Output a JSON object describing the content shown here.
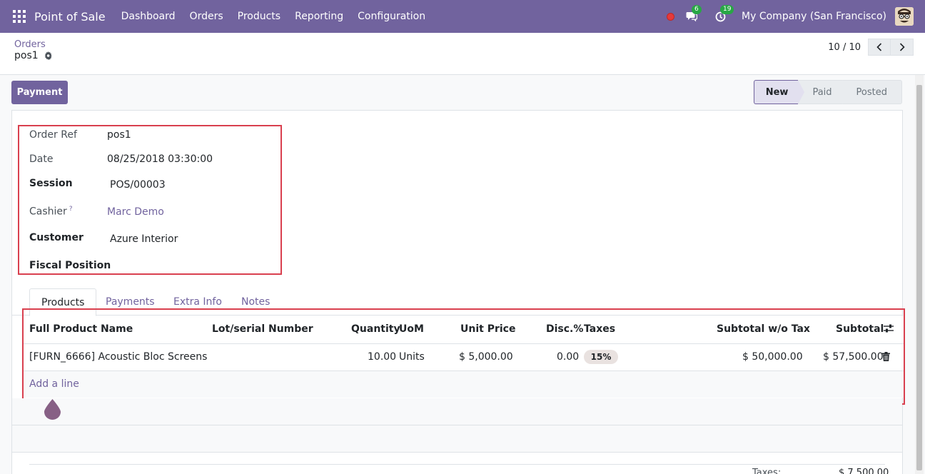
{
  "navbar": {
    "app_title": "Point of Sale",
    "menu": [
      "Dashboard",
      "Orders",
      "Products",
      "Reporting",
      "Configuration"
    ],
    "messages_count": "6",
    "activities_count": "19",
    "company": "My Company (San Francisco)"
  },
  "breadcrumb": {
    "parent": "Orders",
    "current": "pos1"
  },
  "pager": {
    "value": "10 / 10"
  },
  "statusbar": {
    "payment_label": "Payment",
    "steps": [
      "New",
      "Paid",
      "Posted"
    ],
    "active_step": "New"
  },
  "form": {
    "order_ref_label": "Order Ref",
    "order_ref_value": "pos1",
    "date_label": "Date",
    "date_value": "08/25/2018 03:30:00",
    "session_label": "Session",
    "session_value": "POS/00003",
    "cashier_label": "Cashier",
    "cashier_help": "?",
    "cashier_value": "Marc Demo",
    "customer_label": "Customer",
    "customer_value": "Azure Interior",
    "fiscal_label": "Fiscal Position"
  },
  "tabs": [
    "Products",
    "Payments",
    "Extra Info",
    "Notes"
  ],
  "lines": {
    "headers": {
      "product": "Full Product Name",
      "lot": "Lot/serial Number",
      "qty": "Quantity",
      "uom": "UoM",
      "price": "Unit Price",
      "disc": "Disc.%",
      "taxes": "Taxes",
      "subtotal_wo": "Subtotal w/o Tax",
      "subtotal": "Subtotal"
    },
    "row": {
      "product": "[FURN_6666] Acoustic Bloc Screens",
      "qty": "10.00",
      "uom": "Units",
      "price": "$ 5,000.00",
      "disc": "0.00",
      "tax": "15%",
      "subtotal_wo": "$ 50,000.00",
      "subtotal": "$ 57,500.00"
    },
    "add_line": "Add a line"
  },
  "totals": {
    "taxes_label": "Taxes:",
    "taxes_value": "$ 7,500.00"
  },
  "colors": {
    "brand": "#71639e",
    "highlight": "#d9404f"
  }
}
